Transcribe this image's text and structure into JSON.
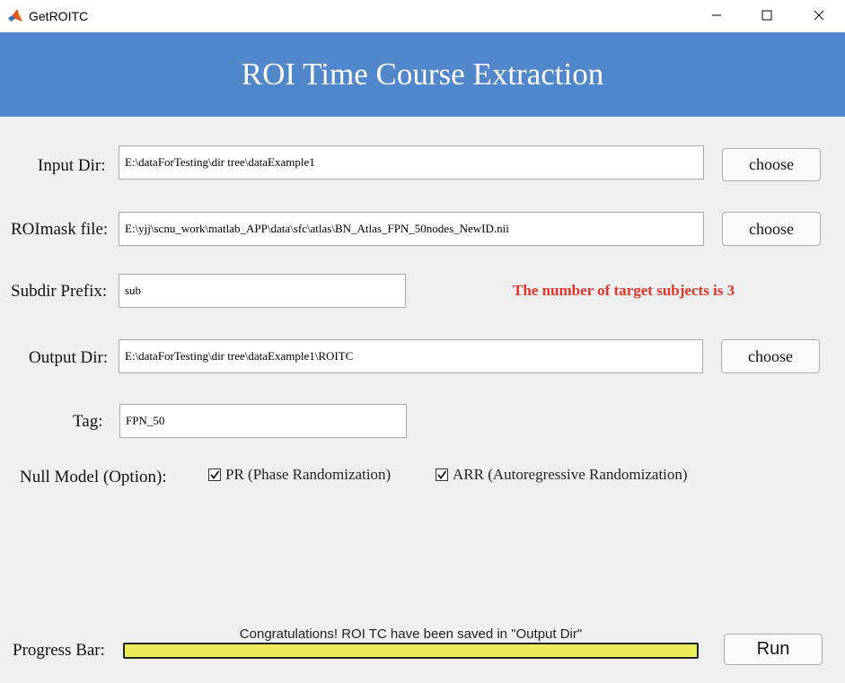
{
  "window": {
    "title": "GetROITC",
    "app_icon": "matlab-icon",
    "controls": [
      "minimize-icon",
      "maximize-icon",
      "close-icon"
    ]
  },
  "header": {
    "title": "ROI Time Course Extraction",
    "background": "#5188cc"
  },
  "form": {
    "input_dir": {
      "label": "Input Dir:",
      "value": "E:\\dataForTesting\\dir tree\\dataExample1",
      "button": "choose"
    },
    "roimask_file": {
      "label": "ROImask file:",
      "value": "E:\\yjj\\scnu_work\\matlab_APP\\data\\sfc\\atlas\\BN_Atlas_FPN_50nodes_NewID.nii",
      "button": "choose"
    },
    "subdir_prefix": {
      "label": "Subdir Prefix:",
      "value": "sub"
    },
    "subject_status": {
      "text": "The number of target subjects is 3",
      "color": "#e8332a"
    },
    "output_dir": {
      "label": "Output Dir:",
      "value": "E:\\dataForTesting\\dir tree\\dataExample1\\ROITC",
      "button": "choose"
    },
    "tag": {
      "label": "Tag:",
      "value": "FPN_50"
    },
    "null_model": {
      "label": "Null Model (Option):",
      "options": [
        {
          "label": "PR (Phase Randomization)",
          "checked": true
        },
        {
          "label": "ARR (Autoregressive Randomization)",
          "checked": true
        }
      ]
    }
  },
  "progress": {
    "label": "Progress Bar:",
    "message": "Congratulations! ROI TC have been saved in \"Output Dir\"",
    "fraction": 1.0,
    "fill_color": "#ecec58"
  },
  "actions": {
    "run_label": "Run"
  }
}
